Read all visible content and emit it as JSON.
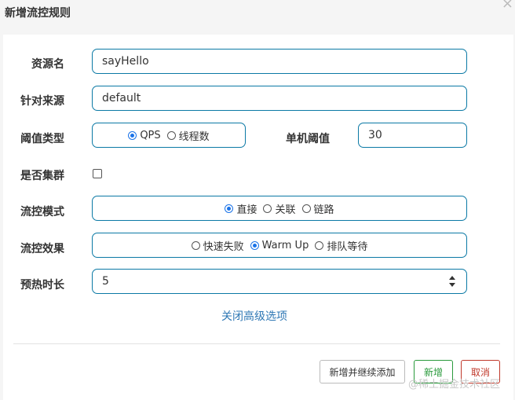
{
  "dialog": {
    "title": "新增流控规则",
    "close_glyph": "×"
  },
  "form": {
    "resource_name": {
      "label": "资源名",
      "value": "sayHello"
    },
    "source": {
      "label": "针对来源",
      "value": "default"
    },
    "threshold_type": {
      "label": "阈值类型",
      "options": [
        "QPS",
        "线程数"
      ],
      "selected": "QPS"
    },
    "single_threshold": {
      "label": "单机阈值",
      "value": "30"
    },
    "cluster": {
      "label": "是否集群",
      "checked": false
    },
    "flow_mode": {
      "label": "流控模式",
      "options": [
        "直接",
        "关联",
        "链路"
      ],
      "selected": "直接"
    },
    "flow_effect": {
      "label": "流控效果",
      "options": [
        "快速失败",
        "Warm Up",
        "排队等待"
      ],
      "selected": "Warm Up"
    },
    "warmup_duration": {
      "label": "预热时长",
      "value": "5"
    }
  },
  "advanced_link": "关闭高级选项",
  "buttons": {
    "add_continue": "新增并继续添加",
    "add": "新增",
    "cancel": "取消"
  },
  "watermark": "@稀土掘金技术社区",
  "colors": {
    "border_accent": "#0b79a5",
    "radio_selected": "#1a73e8",
    "link": "#2f78b5",
    "add_green": "#2a9a3c",
    "cancel_red": "#c0392b"
  }
}
